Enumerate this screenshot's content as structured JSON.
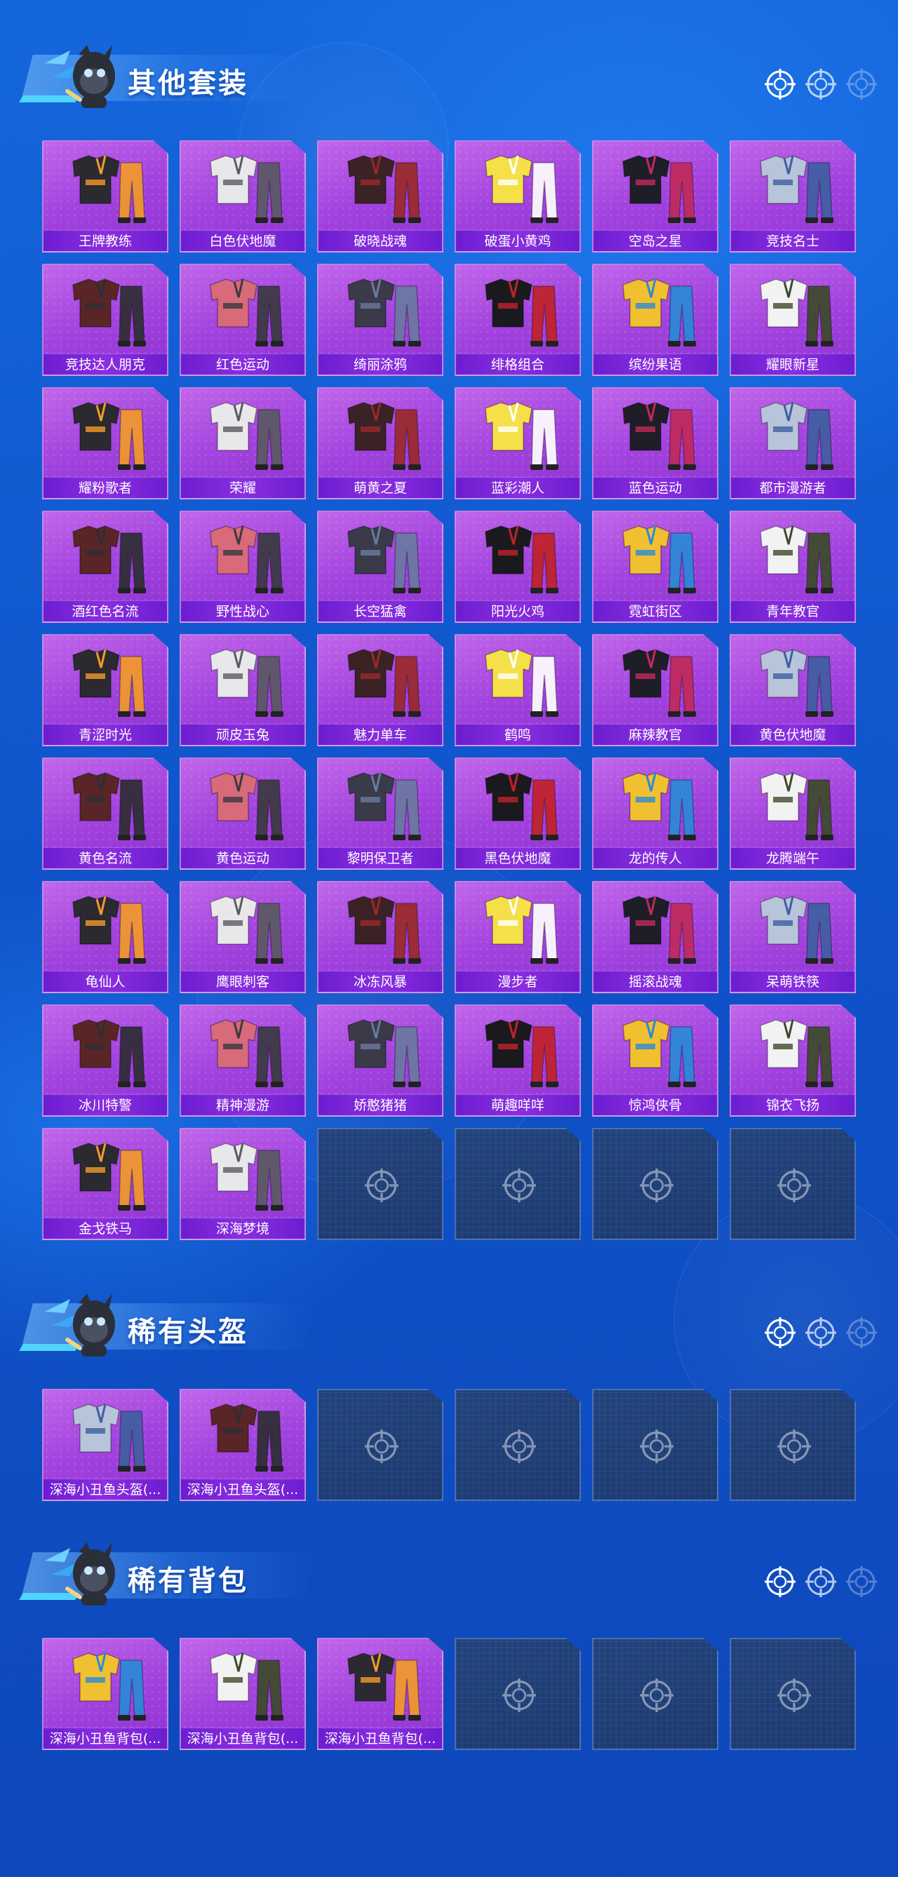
{
  "sections": [
    {
      "title": "其他套装",
      "items": [
        "王牌教练",
        "白色伏地魔",
        "破晓战魂",
        "破蛋小黄鸡",
        "空岛之星",
        "竞技名士",
        "竞技达人朋克",
        "红色运动",
        "绮丽涂鸦",
        "绯格组合",
        "缤纷果语",
        "耀眼新星",
        "耀粉歌者",
        "荣耀",
        "萌黄之夏",
        "蓝彩潮人",
        "蓝色运动",
        "都市漫游者",
        "酒红色名流",
        "野性战心",
        "长空猛禽",
        "阳光火鸡",
        "霓虹街区",
        "青年教官",
        "青涩时光",
        "顽皮玉兔",
        "魅力单车",
        "鹤鸣",
        "麻辣教官",
        "黄色伏地魔",
        "黄色名流",
        "黄色运动",
        "黎明保卫者",
        "黑色伏地魔",
        "龙的传人",
        "龙腾端午",
        "龟仙人",
        "鹰眼刺客",
        "冰冻风暴",
        "漫步者",
        "摇滚战魂",
        "呆萌铁筷",
        "冰川特警",
        "精神漫游",
        "娇憨猪猪",
        "萌趣咩咩",
        "惊鸿侠骨",
        "锦衣飞扬",
        "金戈铁马",
        "深海梦境"
      ],
      "empty_slots": 4
    },
    {
      "title": "稀有头盔",
      "items": [
        "深海小丑鱼头盔(...",
        "深海小丑鱼头盔(..."
      ],
      "empty_slots": 4
    },
    {
      "title": "稀有背包",
      "items": [
        "深海小丑鱼背包(...",
        "深海小丑鱼背包(...",
        "深海小丑鱼背包(..."
      ],
      "empty_slots": 3
    }
  ],
  "colors": {
    "card_purple": "#a243de",
    "label_purple": "#7a24d8",
    "empty_slot": "#1f3f77",
    "background": "#1260d6"
  }
}
